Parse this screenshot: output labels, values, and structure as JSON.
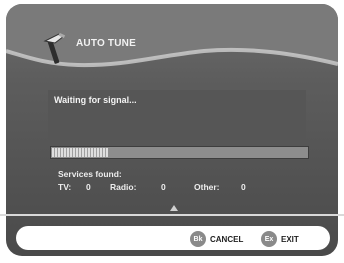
{
  "window": {
    "title": "AUTO TUNE"
  },
  "status": {
    "message": "Waiting for signal..."
  },
  "progress": {
    "value": 0.22
  },
  "services": {
    "title": "Services found:",
    "tv_label": "TV:",
    "tv_value": "0",
    "radio_label": "Radio:",
    "radio_value": "0",
    "other_label": "Other:",
    "other_value": "0"
  },
  "buttons": [
    {
      "icon": "Bk",
      "label": "CANCEL"
    },
    {
      "icon": "Ex",
      "label": "EXIT"
    }
  ],
  "icons": {
    "title_icon": "tool-icon",
    "up_arrow": "up-arrow-icon"
  }
}
